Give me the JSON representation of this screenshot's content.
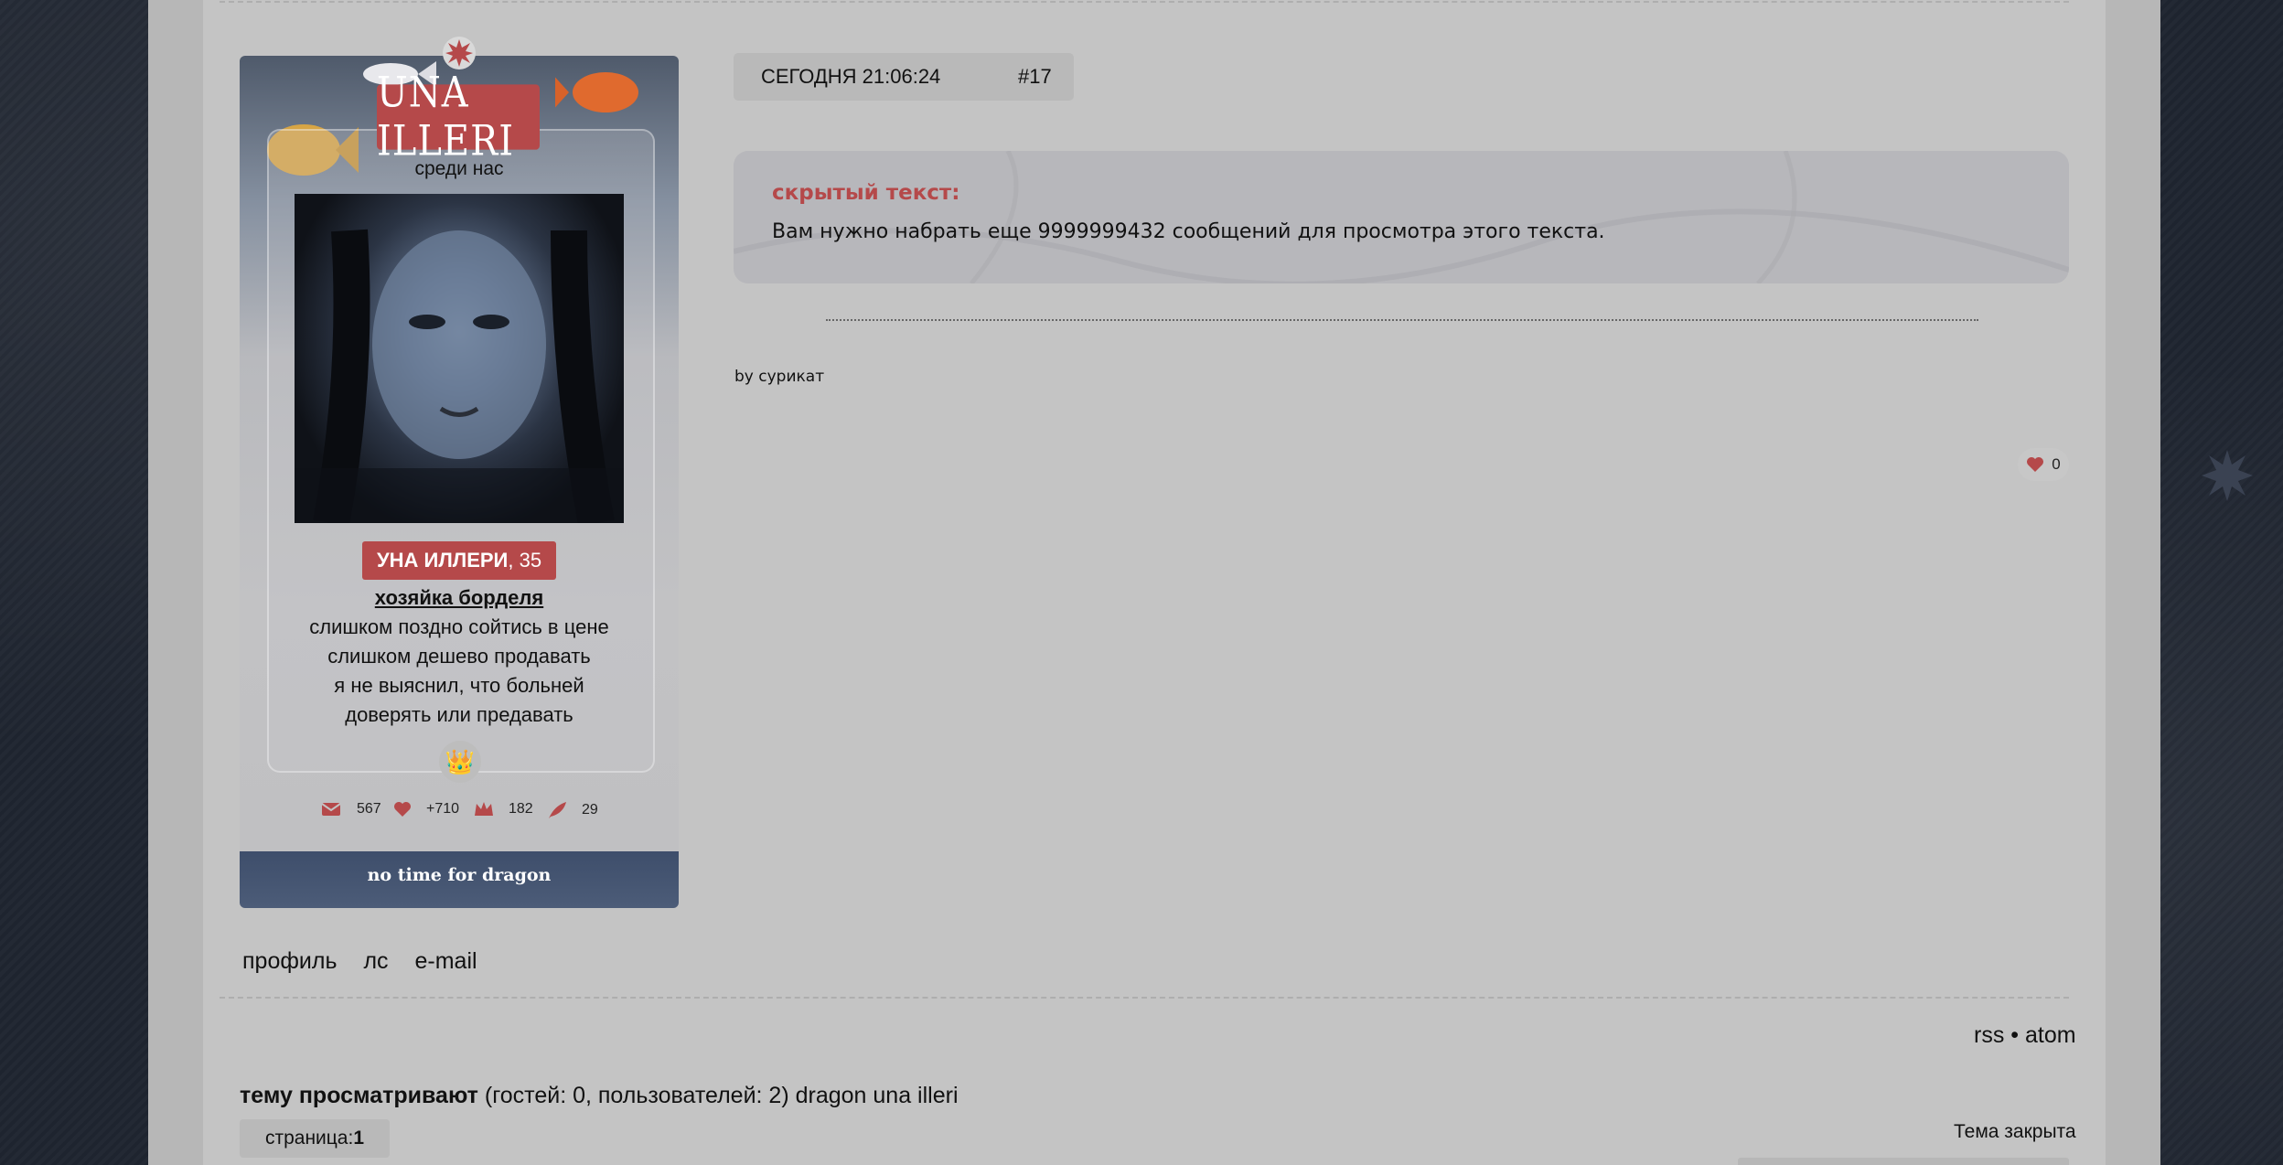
{
  "profile": {
    "nick": "UNA ILLERI",
    "status": "среди нас",
    "display_name": "УНА ИЛЛЕРИ",
    "age": ", 35",
    "role": "хозяйка борделя",
    "lyrics": [
      "слишком поздно сойтись в цене",
      "слишком дешево продавать",
      "я не выяснил, что больней",
      "доверять или предавать"
    ],
    "crown_glyph": "👑",
    "stats": {
      "messages": "567",
      "respect": "+710",
      "positive": "182",
      "posts": "29"
    },
    "footer": "no time for dragon"
  },
  "post": {
    "date": "СЕГОДНЯ 21:06:24",
    "number": "#17",
    "hidden_title": "скрытый текст:",
    "hidden_message": "Вам нужно набрать еще 9999999432 сообщений для просмотра этого текста.",
    "signature": "by сурикат",
    "likes": "0",
    "links": [
      "профиль",
      "лс",
      "e-mail"
    ]
  },
  "footer": {
    "feeds": "rss • atom",
    "viewers_label": "тему просматривают",
    "viewers_info": " (гостей: 0, пользователей: 2) dragon una illeri",
    "page_label": "страница: ",
    "page_number": "1",
    "topic_status": "Тема закрыта"
  },
  "colors": {
    "accent": "#b5494a",
    "panel": "#c4c4c4",
    "background": "#1f2530"
  },
  "icons": [
    "envelope-icon",
    "heart-icon",
    "crown-icon",
    "feather-icon",
    "star-icon"
  ]
}
